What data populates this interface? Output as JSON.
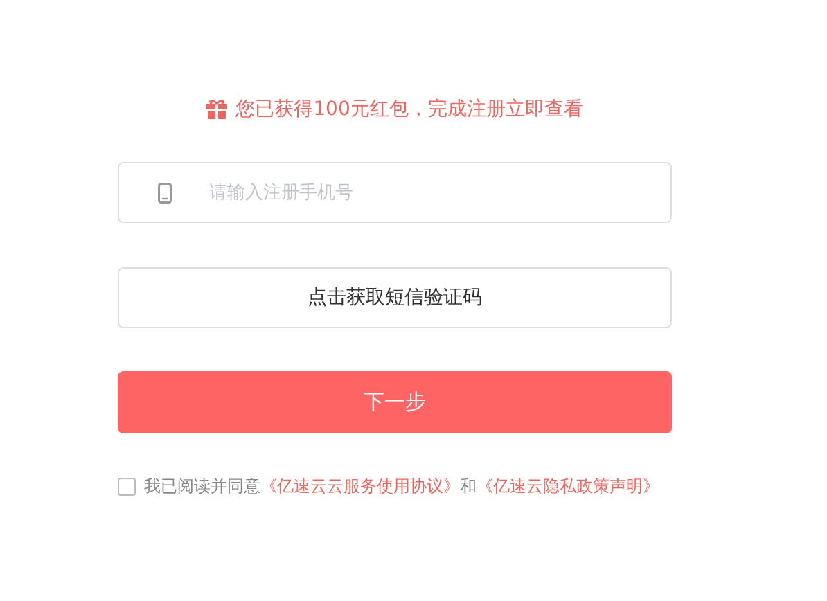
{
  "bonus_notice": {
    "text": "您已获得100元红包，完成注册立即查看"
  },
  "phone_field": {
    "placeholder": "请输入注册手机号"
  },
  "sms_button": {
    "label": "点击获取短信验证码"
  },
  "next_button": {
    "label": "下一步"
  },
  "agreement": {
    "checked": false,
    "prefix": "我已阅读并同意",
    "links": [
      {
        "text": "《亿速云云服务使用协议》"
      },
      {
        "text": "《亿速云隐私政策声明》"
      }
    ],
    "joiner": "和"
  }
}
